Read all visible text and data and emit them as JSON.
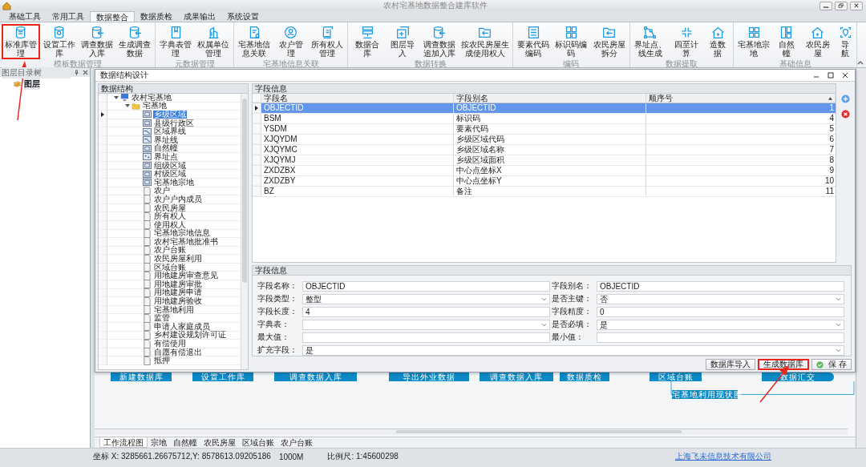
{
  "window": {
    "title": "农村宅基地数据整合建库软件"
  },
  "menu_tabs": [
    {
      "label": "基础工具",
      "selected": false
    },
    {
      "label": "常用工具",
      "selected": false
    },
    {
      "label": "数据整合",
      "selected": true
    },
    {
      "label": "数据质检",
      "selected": false
    },
    {
      "label": "成果输出",
      "selected": false
    },
    {
      "label": "系统设置",
      "selected": false
    }
  ],
  "ribbon": {
    "groups": [
      {
        "label": "模板数据管理",
        "buttons": [
          {
            "label": "标准库管理",
            "highlighted": true
          },
          {
            "label": "设置工作库",
            "highlighted": false
          },
          {
            "label": "调查数据入库",
            "highlighted": false
          },
          {
            "label": "生成调查数据",
            "highlighted": false
          }
        ]
      },
      {
        "label": "元数据管理",
        "buttons": [
          {
            "label": "字典表管理",
            "highlighted": false
          },
          {
            "label": "权属单位管理",
            "highlighted": false
          }
        ]
      },
      {
        "label": "宅基地信息关联",
        "buttons": [
          {
            "label": "宅基地信息关联",
            "highlighted": false
          },
          {
            "label": "农户管理",
            "highlighted": false
          },
          {
            "label": "所有权人管理",
            "highlighted": false
          }
        ]
      },
      {
        "label": "数据转换",
        "buttons": [
          {
            "label": "数据合库",
            "highlighted": false
          },
          {
            "label": "图层导入",
            "highlighted": false
          },
          {
            "label": "调查数据追加入库",
            "highlighted": false
          },
          {
            "label": "按农民房屋生成使用权人",
            "highlighted": false
          }
        ]
      },
      {
        "label": "编码",
        "buttons": [
          {
            "label": "要素代码编码",
            "highlighted": false
          },
          {
            "label": "标识码编码",
            "highlighted": false
          },
          {
            "label": "农民房屋拆分",
            "highlighted": false
          }
        ]
      },
      {
        "label": "数据提取",
        "buttons": [
          {
            "label": "界址点、线生成",
            "highlighted": false
          },
          {
            "label": "四至计算",
            "highlighted": false
          },
          {
            "label": "造数据",
            "highlighted": false
          }
        ]
      },
      {
        "label": "基础信息",
        "buttons": [
          {
            "label": "宅基地宗地",
            "highlighted": false
          },
          {
            "label": "自然幢",
            "highlighted": false
          },
          {
            "label": "农民房屋",
            "highlighted": false
          },
          {
            "label": "导航",
            "highlighted": false
          }
        ]
      }
    ]
  },
  "layer_panel": {
    "title": "图层目录树",
    "tree": [
      {
        "label": "图层"
      }
    ]
  },
  "dialog": {
    "title": "数据结构设计",
    "structure": {
      "title": "数据结构",
      "tree": [
        {
          "label": "农村宅基地",
          "kind": "database",
          "expanded": true,
          "selected": false,
          "children": [
            {
              "label": "宅基地",
              "kind": "folder",
              "expanded": true,
              "selected": false,
              "children": [
                {
                  "label": "乡级区域",
                  "kind": "polygon",
                  "selected": true
                },
                {
                  "label": "县级行政区",
                  "kind": "polygon",
                  "selected": false
                },
                {
                  "label": "区域界线",
                  "kind": "line",
                  "selected": false
                },
                {
                  "label": "界址线",
                  "kind": "line",
                  "selected": false
                },
                {
                  "label": "自然幢",
                  "kind": "polygon",
                  "selected": false
                },
                {
                  "label": "界址点",
                  "kind": "point",
                  "selected": false
                },
                {
                  "label": "组级区域",
                  "kind": "polygon",
                  "selected": false
                },
                {
                  "label": "村级区域",
                  "kind": "polygon",
                  "selected": false
                },
                {
                  "label": "宅基地宗地",
                  "kind": "polygon",
                  "selected": false
                },
                {
                  "label": "农户",
                  "kind": "table",
                  "selected": false
                },
                {
                  "label": "农户户内成员",
                  "kind": "table",
                  "selected": false
                },
                {
                  "label": "农民房屋",
                  "kind": "table",
                  "selected": false
                },
                {
                  "label": "所有权人",
                  "kind": "table",
                  "selected": false
                },
                {
                  "label": "使用权人",
                  "kind": "table",
                  "selected": false
                },
                {
                  "label": "宅基地宗地信息",
                  "kind": "table",
                  "selected": false
                },
                {
                  "label": "农村宅基地批准书",
                  "kind": "table",
                  "selected": false
                },
                {
                  "label": "农户台账",
                  "kind": "table",
                  "selected": false
                },
                {
                  "label": "农民房屋利用",
                  "kind": "table",
                  "selected": false
                },
                {
                  "label": "区域台账",
                  "kind": "table",
                  "selected": false
                },
                {
                  "label": "用地建房审查意见",
                  "kind": "table",
                  "selected": false
                },
                {
                  "label": "用地建房审批",
                  "kind": "table",
                  "selected": false
                },
                {
                  "label": "用地建房申请",
                  "kind": "table",
                  "selected": false
                },
                {
                  "label": "用地建房验收",
                  "kind": "table",
                  "selected": false
                },
                {
                  "label": "宅基地利用",
                  "kind": "table",
                  "selected": false
                },
                {
                  "label": "监管",
                  "kind": "table",
                  "selected": false
                },
                {
                  "label": "申请人家庭成员",
                  "kind": "table",
                  "selected": false
                },
                {
                  "label": "乡村建设规划许可证",
                  "kind": "table",
                  "selected": false
                },
                {
                  "label": "有偿使用",
                  "kind": "table",
                  "selected": false
                },
                {
                  "label": "自愿有偿退出",
                  "kind": "table",
                  "selected": false
                },
                {
                  "label": "抵押",
                  "kind": "table",
                  "selected": false
                }
              ]
            }
          ]
        }
      ]
    },
    "fields_table": {
      "title": "字段信息",
      "columns": [
        "字段名",
        "字段别名",
        "顺序号"
      ],
      "rows": [
        {
          "name": "OBJECTID",
          "alias": "OBJECTID",
          "order": "1",
          "selected": true
        },
        {
          "name": "BSM",
          "alias": "标识码",
          "order": "4",
          "selected": false
        },
        {
          "name": "YSDM",
          "alias": "要素代码",
          "order": "5",
          "selected": false
        },
        {
          "name": "XJQYDM",
          "alias": "乡级区域代码",
          "order": "6",
          "selected": false
        },
        {
          "name": "XJQYMC",
          "alias": "乡级区域名称",
          "order": "7",
          "selected": false
        },
        {
          "name": "XJQYMJ",
          "alias": "乡级区域面积",
          "order": "8",
          "selected": false
        },
        {
          "name": "ZXDZBX",
          "alias": "中心点坐标X",
          "order": "9",
          "selected": false
        },
        {
          "name": "ZXDZBY",
          "alias": "中心点坐标Y",
          "order": "10",
          "selected": false
        },
        {
          "name": "BZ",
          "alias": "备注",
          "order": "11",
          "selected": false
        }
      ]
    },
    "field_info": {
      "title": "字段信息",
      "rows": [
        [
          {
            "label": "字段名称：",
            "kind": "text",
            "value": "OBJECTID"
          },
          {
            "label": "字段别名：",
            "kind": "text",
            "value": "OBJECTID"
          }
        ],
        [
          {
            "label": "字段类型：",
            "kind": "select",
            "value": "整型"
          },
          {
            "label": "是否主键：",
            "kind": "select",
            "value": "否"
          }
        ],
        [
          {
            "label": "字段长度：",
            "kind": "text",
            "value": "4"
          },
          {
            "label": "字段精度：",
            "kind": "text",
            "value": "0"
          }
        ],
        [
          {
            "label": "字典表：",
            "kind": "select"
          },
          {
            "label": "是否必填：",
            "kind": "select",
            "value": "是"
          }
        ],
        [
          {
            "label": "最大值：",
            "kind": "text"
          },
          {
            "label": "最小值：",
            "kind": "text"
          }
        ],
        [
          {
            "label": "扩充字段：",
            "kind": "select",
            "value": "是"
          }
        ]
      ]
    },
    "buttons": [
      {
        "label": "数据库导入",
        "kind": "plain",
        "highlighted": false
      },
      {
        "label": "生成数据库",
        "kind": "plain",
        "highlighted": true
      },
      {
        "label": "保 存",
        "kind": "save",
        "highlighted": false
      }
    ]
  },
  "workflow": {
    "nodes": [
      {
        "label": "新建数据库"
      },
      {
        "label": "设置工作库"
      },
      {
        "label": "调查数据入库"
      },
      {
        "label": "导出外业数据"
      },
      {
        "label": "调查数据入库"
      },
      {
        "label": "数据质检"
      },
      {
        "label": "区域台账"
      },
      {
        "label": "数据汇交"
      },
      {
        "label": "宅基地利用现状图"
      }
    ]
  },
  "bottom_tabs": [
    {
      "label": "工作流程图",
      "selected": true
    },
    {
      "label": "宗地",
      "selected": false
    },
    {
      "label": "自然幢",
      "selected": false
    },
    {
      "label": "农民房屋",
      "selected": false
    },
    {
      "label": "区域台账",
      "selected": false
    },
    {
      "label": "农户台账",
      "selected": false
    }
  ],
  "status_bar": {
    "coordinates": "坐标 X: 3285661.26675712,Y: 8578613.09205186",
    "unit": "1000M",
    "scale": "比例尺: 1:45600298",
    "company_link": "上海飞未信息技术有限公司"
  }
}
